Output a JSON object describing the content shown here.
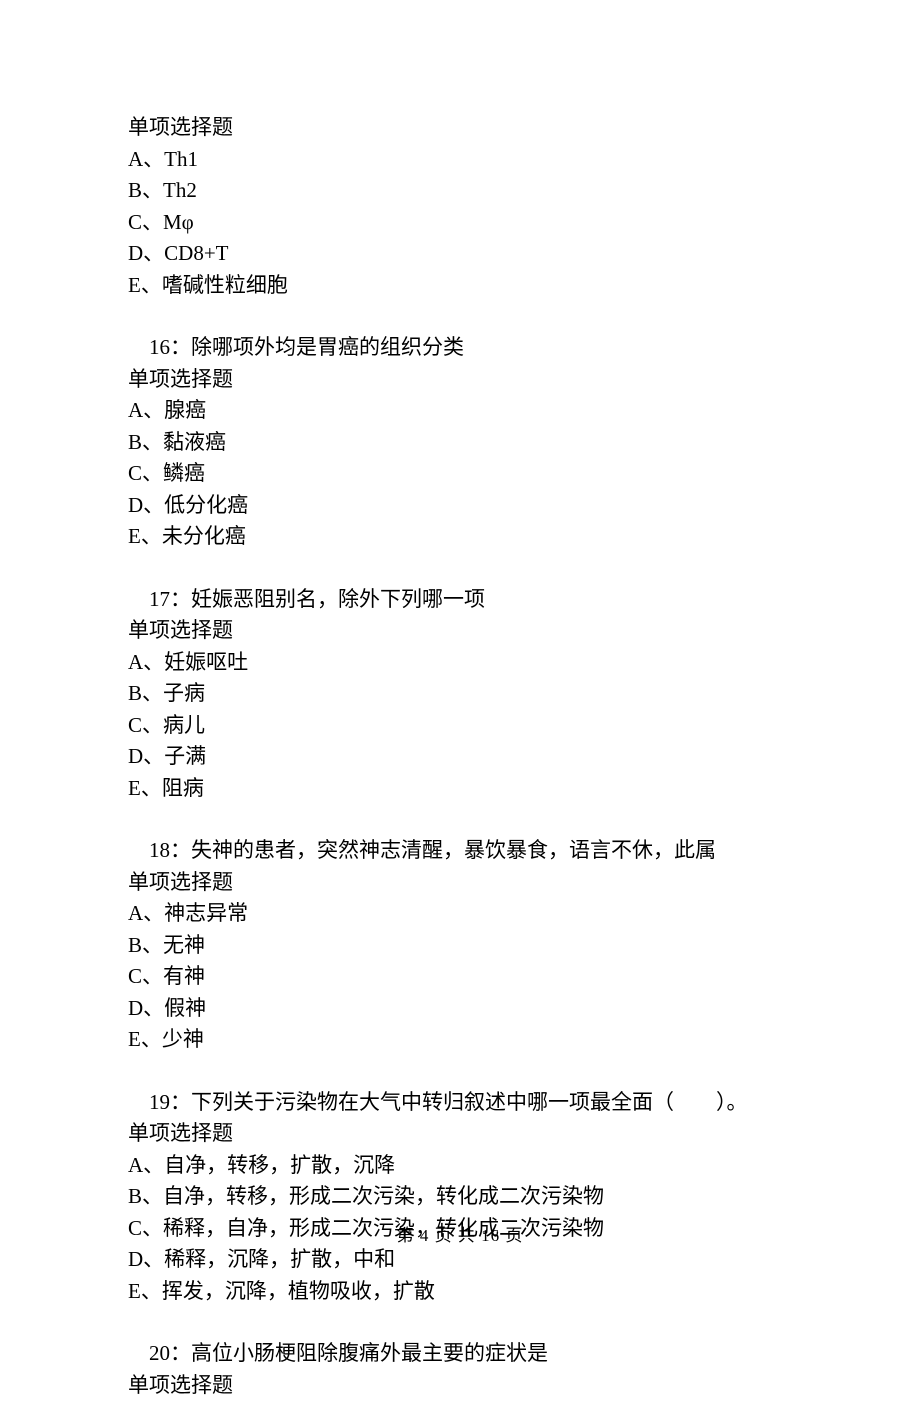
{
  "q15": {
    "type_label": "单项选择题",
    "options": {
      "A": "A、Th1",
      "B": "B、Th2",
      "C": "C、Mφ",
      "D": "D、CD8+T",
      "E": "E、嗜碱性粒细胞"
    }
  },
  "q16": {
    "stem": "16：除哪项外均是胃癌的组织分类",
    "type_label": "单项选择题",
    "options": {
      "A": "A、腺癌",
      "B": "B、黏液癌",
      "C": "C、鳞癌",
      "D": "D、低分化癌",
      "E": "E、未分化癌"
    }
  },
  "q17": {
    "stem": "17：妊娠恶阻别名，除外下列哪一项",
    "type_label": "单项选择题",
    "options": {
      "A": "A、妊娠呕吐",
      "B": "B、子病",
      "C": "C、病儿",
      "D": "D、子满",
      "E": "E、阻病"
    }
  },
  "q18": {
    "stem": "18：失神的患者，突然神志清醒，暴饮暴食，语言不休，此属",
    "type_label": "单项选择题",
    "options": {
      "A": "A、神志异常",
      "B": "B、无神",
      "C": "C、有神",
      "D": "D、假神",
      "E": "E、少神"
    }
  },
  "q19": {
    "stem": "19：下列关于污染物在大气中转归叙述中哪一项最全面（　　）。",
    "type_label": "单项选择题",
    "options": {
      "A": "A、自净，转移，扩散，沉降",
      "B": "B、自净，转移，形成二次污染，转化成二次污染物",
      "C": "C、稀释，自净，形成二次污染，转化成二次污染物",
      "D": "D、稀释，沉降，扩散，中和",
      "E": "E、挥发，沉降，植物吸收，扩散"
    }
  },
  "q20": {
    "stem": "20：高位小肠梗阻除腹痛外最主要的症状是",
    "type_label": "单项选择题"
  },
  "footer": {
    "prefix": "第 ",
    "page": "4",
    "middle": " 页 共 ",
    "total": "16",
    "suffix": " 页"
  }
}
